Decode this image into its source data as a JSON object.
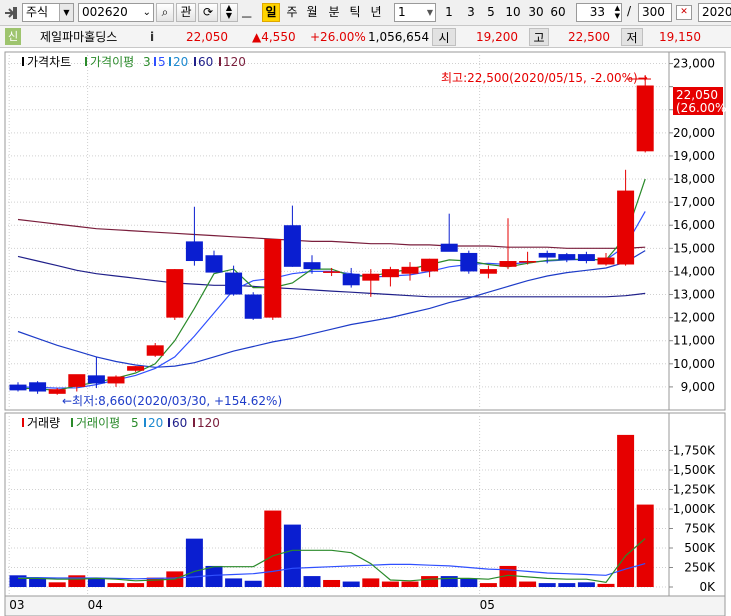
{
  "toolbar": {
    "market_type": "주식",
    "stock_code": "002620",
    "tab_interest": "관",
    "periods": [
      "일",
      "주",
      "월",
      "분",
      "틱",
      "년"
    ],
    "active_period": "일",
    "interval_value": "1",
    "quick_intervals": [
      "1",
      "3",
      "5",
      "10",
      "30",
      "60"
    ],
    "zoom_value": "33",
    "zoom_separator": "/",
    "total_count": "300",
    "date_field": "2020/"
  },
  "quote": {
    "badge": "신",
    "name": "제일파마홀딩스",
    "info_icon": "i",
    "price": "22,050",
    "change": "▲4,550",
    "change_pct": "+26.00%",
    "volume": "1,056,654",
    "open_label": "시",
    "open": "19,200",
    "high_label": "고",
    "high": "22,500",
    "low_label": "저",
    "low": "19,150"
  },
  "price_panel": {
    "legend": {
      "chart_name": "가격차트",
      "ma_name": "가격이평",
      "ma_periods": [
        "3",
        "5",
        "20",
        "60",
        "120"
      ]
    },
    "high_annotation": "최고:22,500(2020/05/15, -2.00%)→",
    "low_annotation": "←최저:8,660(2020/03/30, +154.62%)",
    "last_price_tag": "22,050",
    "last_pct_tag": "(26.00%)"
  },
  "volume_panel": {
    "legend": {
      "chart_name": "거래량",
      "ma_name": "거래이평",
      "ma_periods": [
        "5",
        "20",
        "60",
        "120"
      ]
    }
  },
  "colors": {
    "up": "#e60000",
    "down": "#0a1ed0",
    "ma3": "#2a8a2a",
    "ma5": "#3050ff",
    "ma20": "#1e3cc8",
    "ma60": "#20208a",
    "ma120": "#7a1e3c",
    "vma5": "#2a8a2a",
    "vma20": "#3050ff"
  },
  "chart_data": [
    {
      "type": "candlestick",
      "ylim": [
        8000,
        23500
      ],
      "y_ticks": [
        "23,000",
        "22,000",
        "21,000",
        "20,000",
        "19,000",
        "18,000",
        "17,000",
        "16,000",
        "15,000",
        "14,000",
        "13,000",
        "12,000",
        "11,000",
        "10,000",
        "9,000"
      ],
      "y_tick_values": [
        23000,
        22000,
        21000,
        20000,
        19000,
        18000,
        17000,
        16000,
        15000,
        14000,
        13000,
        12000,
        11000,
        10000,
        9000
      ],
      "x_labels": [
        "03",
        "04",
        "05"
      ],
      "x_label_index": [
        0,
        4,
        24
      ],
      "candles": [
        {
          "o": 9100,
          "h": 9200,
          "l": 8800,
          "c": 8850
        },
        {
          "o": 9200,
          "h": 9250,
          "l": 8700,
          "c": 8800
        },
        {
          "o": 8700,
          "h": 8950,
          "l": 8660,
          "c": 8900
        },
        {
          "o": 9000,
          "h": 9500,
          "l": 8800,
          "c": 9550
        },
        {
          "o": 9500,
          "h": 10300,
          "l": 8950,
          "c": 9150
        },
        {
          "o": 9150,
          "h": 9500,
          "l": 9000,
          "c": 9450
        },
        {
          "o": 9700,
          "h": 9900,
          "l": 9650,
          "c": 9900
        },
        {
          "o": 10350,
          "h": 10900,
          "l": 10300,
          "c": 10800
        },
        {
          "o": 12000,
          "h": 14100,
          "l": 11900,
          "c": 14100
        },
        {
          "o": 15300,
          "h": 16800,
          "l": 14250,
          "c": 14450
        },
        {
          "o": 14700,
          "h": 14900,
          "l": 13950,
          "c": 13950
        },
        {
          "o": 13950,
          "h": 14250,
          "l": 12950,
          "c": 13000
        },
        {
          "o": 13000,
          "h": 13100,
          "l": 11900,
          "c": 11950
        },
        {
          "o": 12000,
          "h": 15400,
          "l": 11900,
          "c": 15400
        },
        {
          "o": 16000,
          "h": 16850,
          "l": 14200,
          "c": 14200
        },
        {
          "o": 14400,
          "h": 14700,
          "l": 13900,
          "c": 14100
        },
        {
          "o": 14000,
          "h": 14150,
          "l": 13800,
          "c": 14000
        },
        {
          "o": 13900,
          "h": 14150,
          "l": 13300,
          "c": 13400
        },
        {
          "o": 13600,
          "h": 14100,
          "l": 12900,
          "c": 13900
        },
        {
          "o": 13750,
          "h": 14200,
          "l": 13350,
          "c": 14100
        },
        {
          "o": 13900,
          "h": 14400,
          "l": 13600,
          "c": 14200
        },
        {
          "o": 14000,
          "h": 14550,
          "l": 13750,
          "c": 14550
        },
        {
          "o": 15200,
          "h": 16500,
          "l": 14900,
          "c": 14850
        },
        {
          "o": 14800,
          "h": 14900,
          "l": 13900,
          "c": 14000
        },
        {
          "o": 13900,
          "h": 14250,
          "l": 13700,
          "c": 14100
        },
        {
          "o": 14200,
          "h": 16300,
          "l": 14100,
          "c": 14450
        },
        {
          "o": 14450,
          "h": 14850,
          "l": 14300,
          "c": 14450
        },
        {
          "o": 14800,
          "h": 14900,
          "l": 14350,
          "c": 14600
        },
        {
          "o": 14750,
          "h": 14800,
          "l": 14400,
          "c": 14500
        },
        {
          "o": 14750,
          "h": 14850,
          "l": 14350,
          "c": 14450
        },
        {
          "o": 14300,
          "h": 14800,
          "l": 14250,
          "c": 14600
        },
        {
          "o": 14300,
          "h": 18400,
          "l": 14250,
          "c": 17500
        },
        {
          "o": 19200,
          "h": 22500,
          "l": 19150,
          "c": 22050
        }
      ],
      "ma3": [
        8950,
        8920,
        8850,
        9050,
        9200,
        9380,
        9600,
        10000,
        11000,
        12400,
        13900,
        14100,
        13300,
        13300,
        13500,
        14100,
        14100,
        13800,
        13800,
        13950,
        14100,
        14300,
        14500,
        14450,
        14300,
        14200,
        14350,
        14480,
        14520,
        14520,
        14500,
        15500,
        18000
      ],
      "ma5": [
        9000,
        8980,
        8950,
        8960,
        9100,
        9300,
        9500,
        9800,
        10300,
        11200,
        12200,
        13200,
        13600,
        13700,
        13900,
        14000,
        14000,
        13900,
        13750,
        13800,
        13850,
        14000,
        14200,
        14300,
        14350,
        14300,
        14400,
        14450,
        14500,
        14520,
        14500,
        15100,
        16600
      ],
      "ma20": [
        11400,
        11100,
        10800,
        10550,
        10300,
        10100,
        9950,
        9850,
        9900,
        10050,
        10300,
        10550,
        10750,
        10950,
        11100,
        11300,
        11500,
        11700,
        11850,
        12000,
        12200,
        12400,
        12650,
        12850,
        13100,
        13350,
        13600,
        13800,
        13950,
        14050,
        14150,
        14400,
        14900
      ],
      "ma60": [
        14650,
        14450,
        14250,
        14050,
        13900,
        13800,
        13700,
        13600,
        13500,
        13450,
        13400,
        13400,
        13350,
        13300,
        13250,
        13200,
        13150,
        13100,
        13050,
        13000,
        12950,
        12900,
        12900,
        12900,
        12900,
        12900,
        12900,
        12900,
        12900,
        12900,
        12900,
        12950,
        13050
      ],
      "ma120": [
        16250,
        16150,
        16050,
        15950,
        15850,
        15800,
        15750,
        15700,
        15650,
        15600,
        15550,
        15500,
        15450,
        15400,
        15350,
        15300,
        15300,
        15250,
        15200,
        15200,
        15150,
        15150,
        15100,
        15100,
        15100,
        15050,
        15050,
        15050,
        15000,
        15000,
        15000,
        15000,
        15050
      ]
    },
    {
      "type": "bar",
      "ylim": [
        0,
        2000000
      ],
      "y_ticks": [
        "1,750K",
        "1,500K",
        "1,250K",
        "1,000K",
        "750K",
        "500K",
        "250K",
        "0K"
      ],
      "y_tick_values": [
        1750000,
        1500000,
        1250000,
        1000000,
        750000,
        500000,
        250000,
        0
      ],
      "volumes": [
        150000,
        110000,
        60000,
        150000,
        110000,
        50000,
        50000,
        120000,
        200000,
        620000,
        270000,
        110000,
        80000,
        980000,
        800000,
        140000,
        90000,
        70000,
        110000,
        70000,
        70000,
        140000,
        140000,
        110000,
        50000,
        270000,
        70000,
        50000,
        50000,
        60000,
        40000,
        1950000,
        1056654
      ],
      "vma5": [
        110000,
        110000,
        100000,
        100000,
        110000,
        100000,
        80000,
        90000,
        100000,
        200000,
        260000,
        260000,
        260000,
        400000,
        470000,
        470000,
        470000,
        440000,
        300000,
        90000,
        80000,
        100000,
        110000,
        110000,
        100000,
        150000,
        130000,
        110000,
        100000,
        100000,
        60000,
        400000,
        620000
      ],
      "vma20": [
        120000,
        120000,
        115000,
        115000,
        115000,
        110000,
        105000,
        110000,
        115000,
        130000,
        150000,
        160000,
        170000,
        200000,
        240000,
        250000,
        260000,
        270000,
        280000,
        290000,
        290000,
        280000,
        270000,
        250000,
        230000,
        220000,
        200000,
        180000,
        170000,
        160000,
        150000,
        230000,
        300000
      ]
    }
  ]
}
